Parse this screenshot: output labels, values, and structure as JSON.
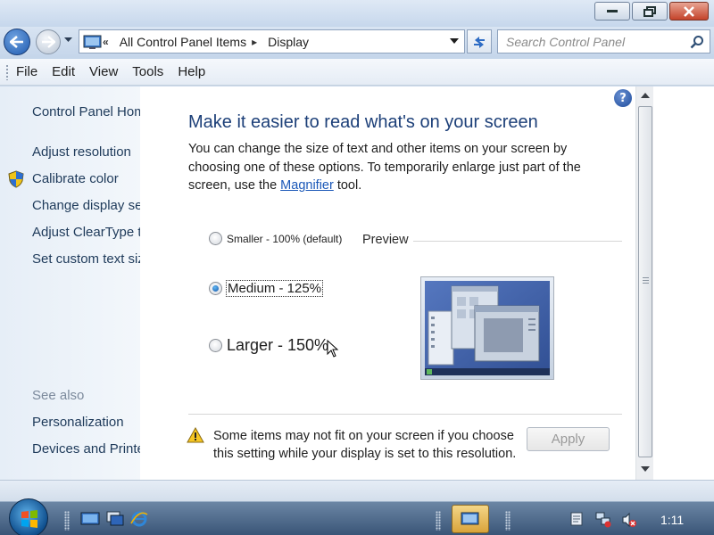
{
  "address": {
    "breadcrumb": [
      "All Control Panel Items",
      "Display"
    ],
    "overflow_chevron": "«"
  },
  "search": {
    "placeholder": "Search Control Panel"
  },
  "menu": [
    "File",
    "Edit",
    "View",
    "Tools",
    "Help"
  ],
  "sidebar": {
    "items": [
      {
        "label": "Control Panel Hom"
      },
      {
        "label": "Adjust resolution"
      },
      {
        "label": "Calibrate color",
        "icon": "shield-icon"
      },
      {
        "label": "Change display set"
      },
      {
        "label": "Adjust ClearType t"
      },
      {
        "label": "Set custom text siz"
      }
    ],
    "see_also_heading": "See also",
    "see_also": [
      {
        "label": "Personalization"
      },
      {
        "label": "Devices and Printe"
      }
    ]
  },
  "main": {
    "heading": "Make it easier to read what's on your screen",
    "description_before_link": "You can change the size of text and other items on your screen by choosing one of these options. To temporarily enlarge just part of the screen, use the ",
    "description_link": "Magnifier",
    "description_after_link": " tool.",
    "options": [
      {
        "label": "Smaller - 100% (default)",
        "checked": false
      },
      {
        "label": "Medium - 125%",
        "checked": true
      },
      {
        "label": "Larger - 150%",
        "checked": false
      }
    ],
    "preview_label": "Preview",
    "warning": "Some items may not fit on your screen if you choose this setting while your display is set to this resolution.",
    "apply_label": "Apply",
    "help_label": "?"
  },
  "taskbar": {
    "clock": "1:11"
  },
  "colors": {
    "heading": "#1c3f78",
    "link": "#1b58b8",
    "taskbar": "#3a5577"
  }
}
